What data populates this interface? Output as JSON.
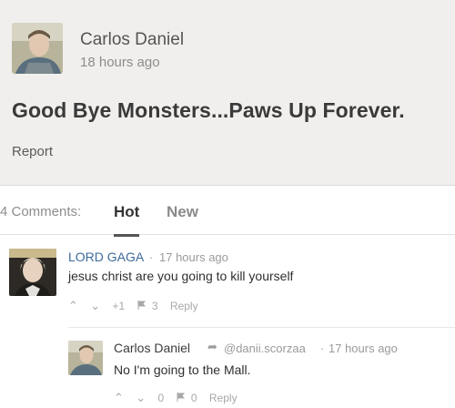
{
  "post": {
    "author": "Carlos Daniel",
    "time": "18 hours ago",
    "body": "Good Bye Monsters...Paws Up Forever.",
    "report_label": "Report"
  },
  "tabs": {
    "count_label": "4 Comments:",
    "hot_label": "Hot",
    "new_label": "New"
  },
  "comments": [
    {
      "author": "LORD GAGA",
      "separator": "·",
      "time": "17 hours ago",
      "text": "jesus christ are you going to kill yourself",
      "upvote_icon": "⌃",
      "downvote_icon": "⌄",
      "score": "+1",
      "flag_count": "3",
      "reply_label": "Reply"
    },
    {
      "author": "Carlos Daniel",
      "reply_arrow": "➦",
      "reply_to": "@danii.scorzaa",
      "separator": "·",
      "time": "17 hours ago",
      "text": "No I'm going to the Mall.",
      "upvote_icon": "⌃",
      "downvote_icon": "⌄",
      "score": "0",
      "flag_count": "0",
      "reply_label": "Reply"
    }
  ],
  "colors": {
    "post_bg": "#f1efed",
    "author_link": "#3d6a99",
    "muted": "#9a9a9a"
  }
}
